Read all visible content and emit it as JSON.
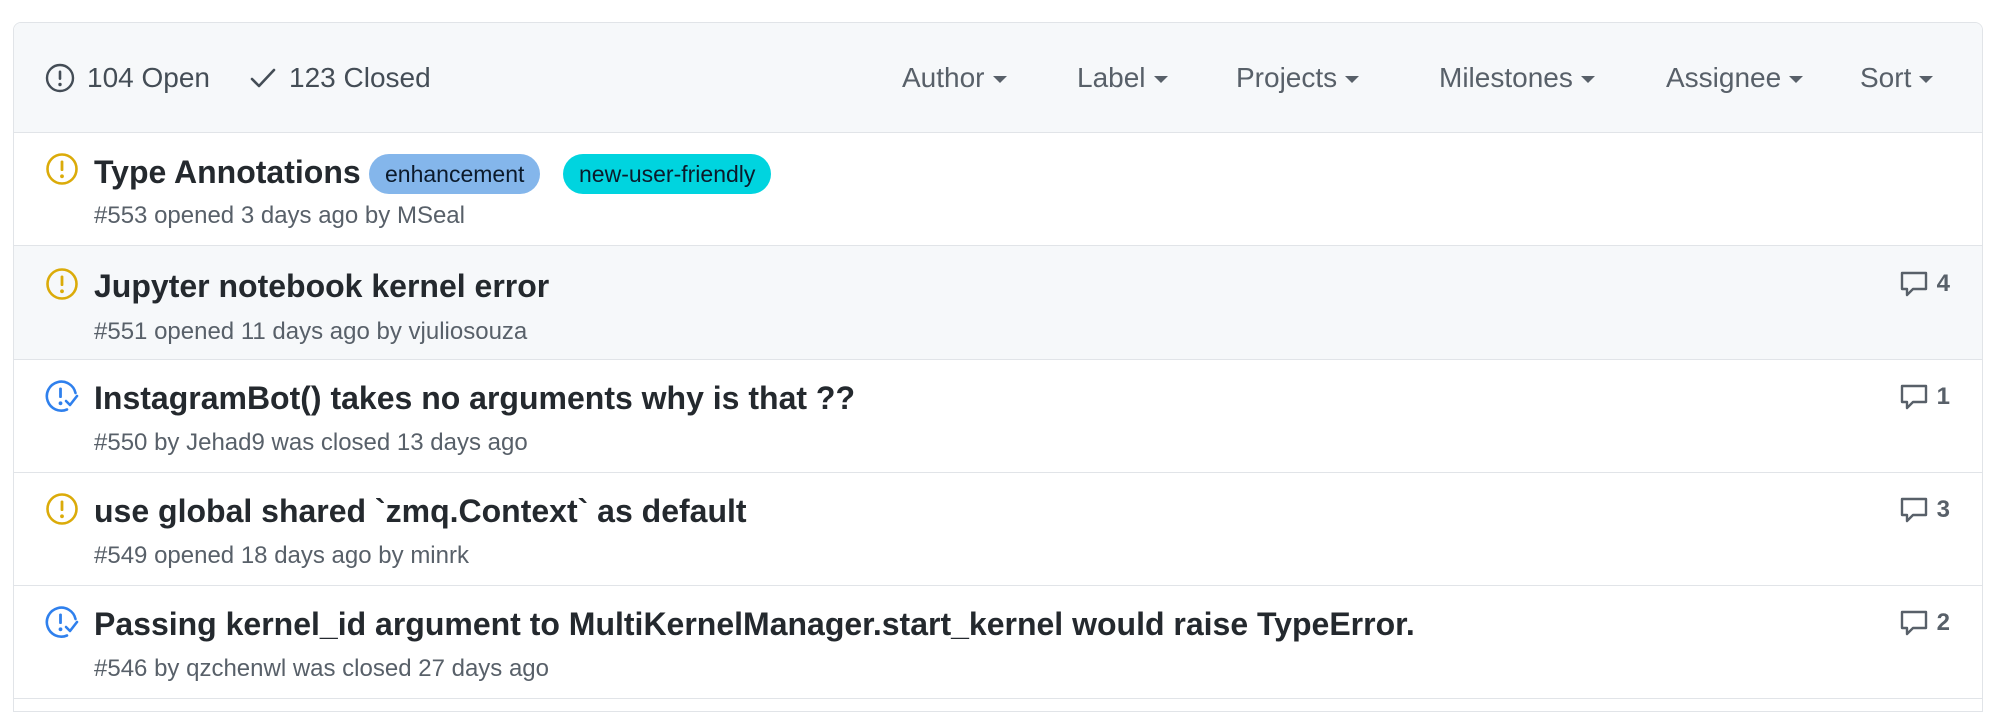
{
  "header": {
    "open_count": "104 Open",
    "closed_count": "123 Closed",
    "filters": [
      "Author",
      "Label",
      "Projects",
      "Milestones",
      "Assignee",
      "Sort"
    ]
  },
  "issues": [
    {
      "title": "Type Annotations",
      "state": "open",
      "number": "#553",
      "meta_parts": [
        "opened",
        "3 days ago",
        "by",
        "MSeal"
      ],
      "labels": [
        {
          "name": "enhancement",
          "color": "#84b6eb"
        },
        {
          "name": "new-user-friendly",
          "color": "#00d4df"
        }
      ],
      "comments": ""
    },
    {
      "title": "Jupyter notebook kernel error",
      "state": "open",
      "number": "#551",
      "meta_parts": [
        "opened",
        "11 days ago",
        "by",
        "vjuliosouza"
      ],
      "labels": [],
      "comments": "4"
    },
    {
      "title": "InstagramBot() takes no arguments why is that ??",
      "state": "closed",
      "number": "#550",
      "meta_parts": [
        "by",
        "Jehad9",
        "was closed",
        "13 days ago"
      ],
      "labels": [],
      "comments": "1"
    },
    {
      "title": "use global shared `zmq.Context` as default",
      "state": "open",
      "number": "#549",
      "meta_parts": [
        "opened",
        "18 days ago",
        "by",
        "minrk"
      ],
      "labels": [],
      "comments": "3"
    },
    {
      "title": "Passing kernel_id argument to MultiKernelManager.start_kernel would raise TypeError.",
      "state": "closed",
      "number": "#546",
      "meta_parts": [
        "by",
        "qzchenwl",
        "was closed",
        "27 days ago"
      ],
      "labels": [],
      "comments": "2"
    }
  ],
  "colors": {
    "open_icon": "#dbab09",
    "closed_icon": "#2f80ed"
  }
}
